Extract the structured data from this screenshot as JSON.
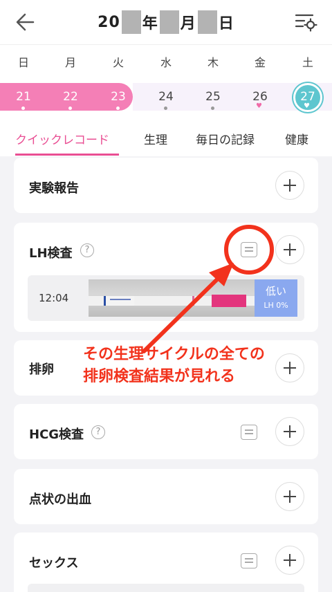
{
  "header": {
    "title_prefix": "20",
    "year_char": "年",
    "month_char": "月",
    "day_char": "日",
    "back_icon": "arrow-left-icon",
    "settings_icon": "list-settings-icon"
  },
  "weekdays": [
    "日",
    "月",
    "火",
    "水",
    "木",
    "金",
    "土"
  ],
  "dates": [
    "21",
    "22",
    "23",
    "24",
    "25",
    "26",
    "27"
  ],
  "tabs": [
    "クイックレコード",
    "生理",
    "毎日の記録",
    "健康"
  ],
  "cards": {
    "experiment": {
      "title": "実験報告"
    },
    "lh": {
      "title": "LH検査",
      "help": "?",
      "entry": {
        "time": "12:04",
        "result": "低い",
        "result_detail": "LH 0%"
      }
    },
    "ovulation": {
      "title": "排卵"
    },
    "hcg": {
      "title": "HCG検査",
      "help": "?"
    },
    "spotting": {
      "title": "点状の出血"
    },
    "sex": {
      "title": "セックス"
    }
  },
  "annotation": {
    "line1": "その生理サイクルの全ての",
    "line2": "排卵検査結果が見れる"
  },
  "colors": {
    "accent_pink": "#e94e93",
    "period_band": "#f47fb6",
    "today": "#5ec6cf",
    "annotation_red": "#f2321c",
    "result_blue": "#8aa8ef"
  }
}
